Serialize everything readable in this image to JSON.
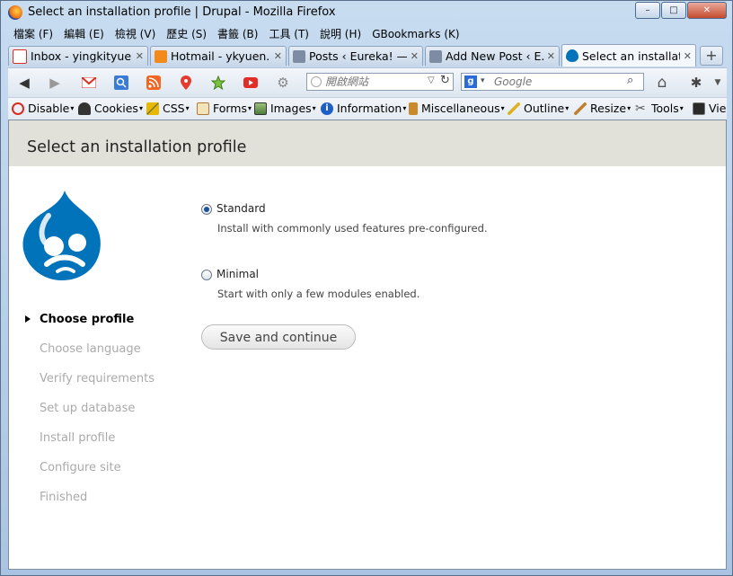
{
  "window": {
    "title": "Select an installation profile | Drupal - Mozilla Firefox",
    "minimize": "–",
    "maximize": "□",
    "close": "✕"
  },
  "menu": [
    {
      "label": "檔案 (F)"
    },
    {
      "label": "編輯 (E)"
    },
    {
      "label": "檢視 (V)"
    },
    {
      "label": "歷史 (S)"
    },
    {
      "label": "書籤 (B)"
    },
    {
      "label": "工具 (T)"
    },
    {
      "label": "說明 (H)"
    },
    {
      "label": "GBookmarks (K)"
    }
  ],
  "tabs": [
    {
      "label": "Inbox - yingkityue...",
      "icon": "gmail-icon",
      "color": "#d93025"
    },
    {
      "label": "Hotmail - ykyuen...",
      "icon": "hotmail-icon",
      "color": "#f28a1c"
    },
    {
      "label": "Posts ‹ Eureka! — ...",
      "icon": "wordpress-icon",
      "color": "#7d8ca3"
    },
    {
      "label": "Add New Post ‹ E...",
      "icon": "wordpress-icon",
      "color": "#7d8ca3"
    },
    {
      "label": "Select an installati...",
      "icon": "drupal-icon",
      "color": "#0073ba"
    }
  ],
  "tab_close": "✕",
  "new_tab": "+",
  "nav": {
    "url_placeholder": "開啟網站",
    "search_placeholder": "Google",
    "search_engine": "g"
  },
  "devbar": [
    {
      "label": "Disable",
      "icon": "disable-icon",
      "color": "#d82a1e"
    },
    {
      "label": "Cookies",
      "icon": "cookies-icon",
      "color": "#333333"
    },
    {
      "label": "CSS",
      "icon": "css-icon",
      "color": "#e6b800"
    },
    {
      "label": "Forms",
      "icon": "forms-icon",
      "color": "#b07a3a"
    },
    {
      "label": "Images",
      "icon": "images-icon",
      "color": "#4b7d3a"
    },
    {
      "label": "Information",
      "icon": "information-icon",
      "color": "#1d5fc7"
    },
    {
      "label": "Miscellaneous",
      "icon": "miscellaneous-icon",
      "color": "#c98a2a"
    },
    {
      "label": "Outline",
      "icon": "outline-icon",
      "color": "#e0b020"
    },
    {
      "label": "Resize",
      "icon": "resize-icon",
      "color": "#c08030"
    },
    {
      "label": "Tools",
      "icon": "tools-icon",
      "color": "#555555"
    },
    {
      "label": "Vie",
      "icon": "view-source-icon",
      "color": "#2a2a2a"
    }
  ],
  "page": {
    "title": "Select an installation profile",
    "steps": [
      {
        "label": "Choose profile",
        "active": true
      },
      {
        "label": "Choose language",
        "active": false
      },
      {
        "label": "Verify requirements",
        "active": false
      },
      {
        "label": "Set up database",
        "active": false
      },
      {
        "label": "Install profile",
        "active": false
      },
      {
        "label": "Configure site",
        "active": false
      },
      {
        "label": "Finished",
        "active": false
      }
    ],
    "options": [
      {
        "label": "Standard",
        "description": "Install with commonly used features pre-configured.",
        "checked": true
      },
      {
        "label": "Minimal",
        "description": "Start with only a few modules enabled.",
        "checked": false
      }
    ],
    "submit_label": "Save and continue",
    "brand_color": "#0073ba"
  }
}
